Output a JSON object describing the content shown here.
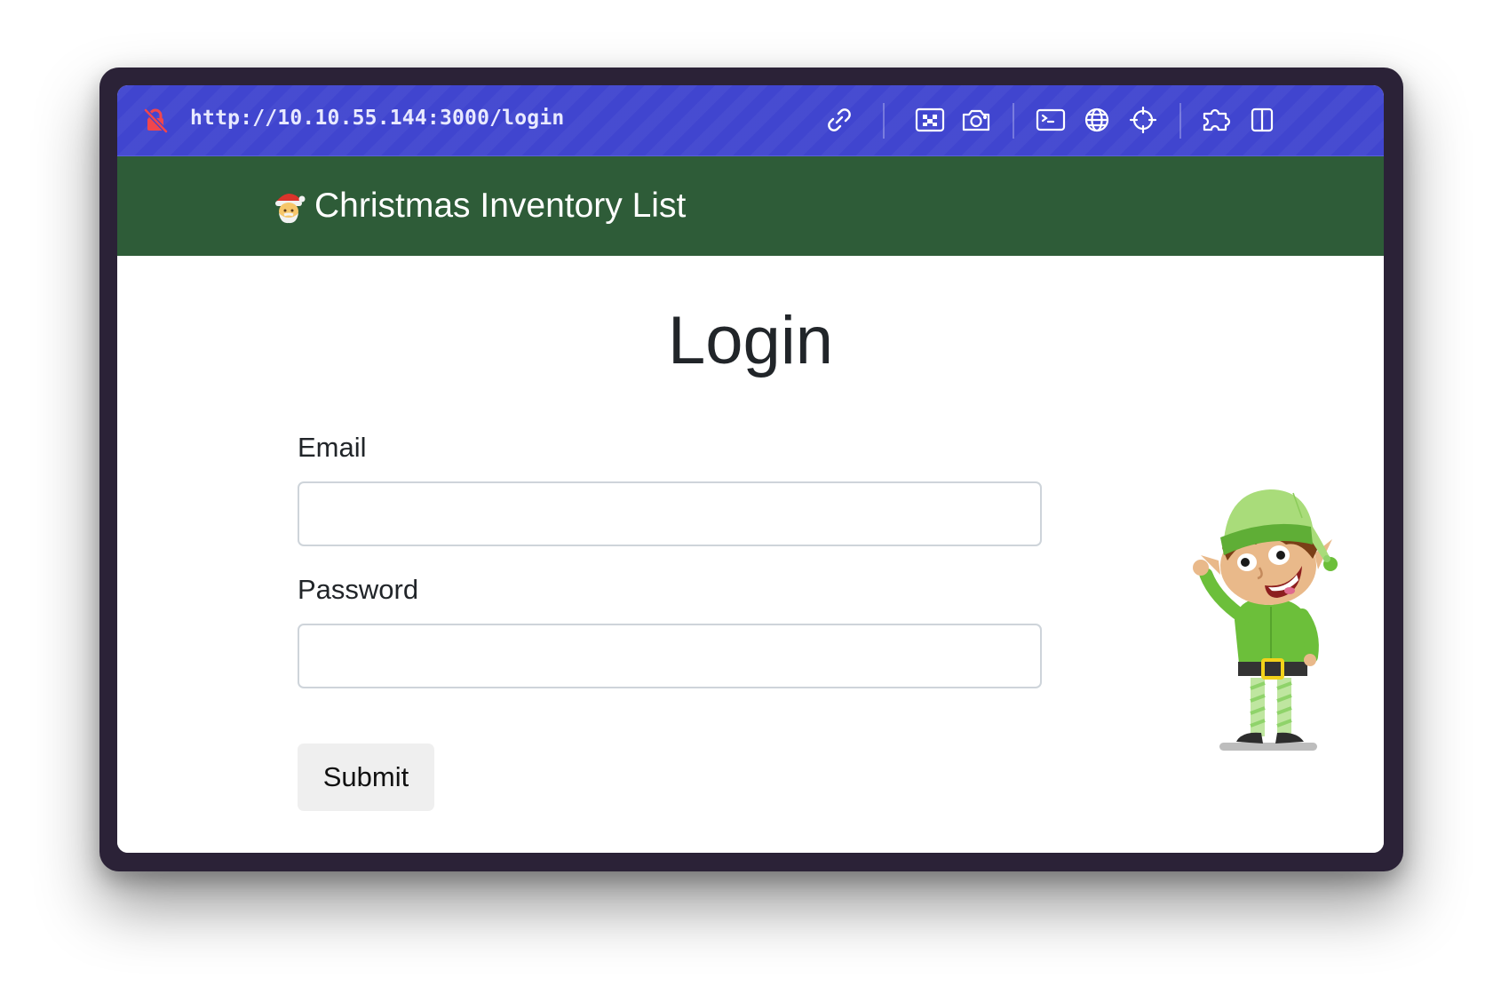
{
  "browser": {
    "url": "http://10.10.55.144:3000/login",
    "toolbar_icons": [
      "link-icon",
      "qr-icon",
      "camera-icon",
      "terminal-icon",
      "globe-icon",
      "crosshair-icon",
      "puzzle-icon",
      "split-view-icon"
    ]
  },
  "navbar": {
    "emoji": "🎅",
    "brand": "Christmas Inventory List"
  },
  "main": {
    "title": "Login",
    "email_label": "Email",
    "email_value": "",
    "password_label": "Password",
    "password_value": "",
    "submit_label": "Submit"
  },
  "colors": {
    "toolbar": "#4045cf",
    "navbar": "#2e5c38",
    "frame": "#2b2237",
    "submit_bg": "#efefef"
  }
}
